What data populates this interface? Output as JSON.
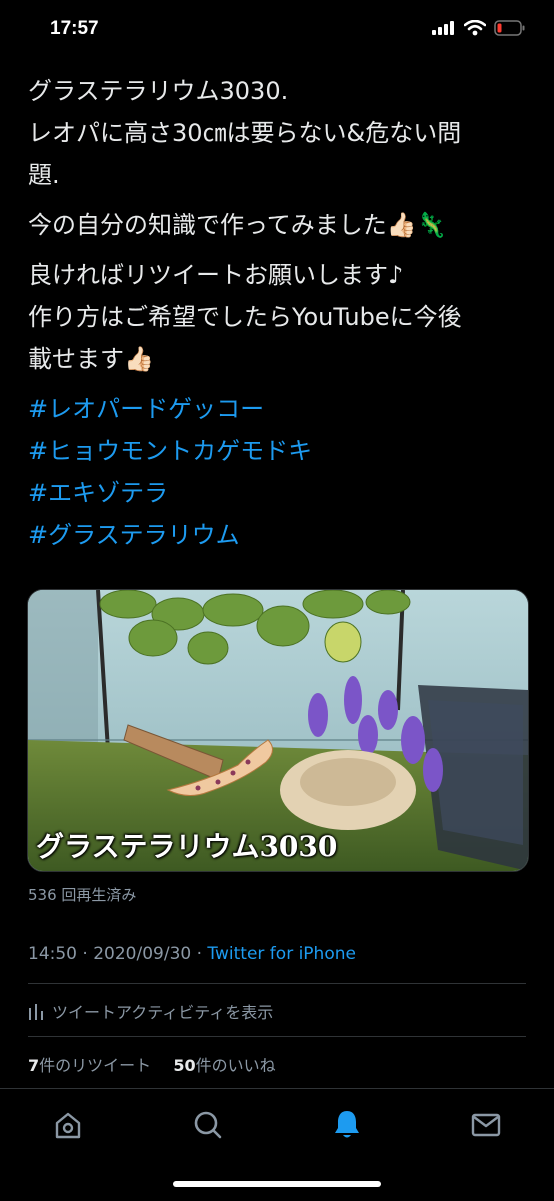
{
  "status_bar": {
    "time": "17:57"
  },
  "tweet": {
    "paragraphs": [
      [
        "グラステラリウム3030.",
        "レオパに高さ30㎝は要らない&危ない問",
        "題."
      ],
      [
        "今の自分の知識で作ってみました👍🏻🦎"
      ],
      [
        "良ければリツイートお願いします♪",
        "作り方はご希望でしたらYouTubeに今後",
        "載せます👍🏻"
      ]
    ],
    "hashtags": [
      "#レオパードゲッコー",
      "#ヒョウモントカゲモドキ",
      "#エキゾテラ",
      "#グラステラリウム"
    ]
  },
  "media": {
    "caption": "グラステラリウム3030"
  },
  "view_count": "536 回再生済み",
  "meta": {
    "time": "14:50",
    "date": "2020/09/30",
    "source": "Twitter for iPhone"
  },
  "activity_label": "ツイートアクティビティを表示",
  "stats": {
    "retweets_count": "7",
    "retweets_label": "件のリツイート",
    "likes_count": "50",
    "likes_label": "件のいいね"
  },
  "tabbar": {
    "active_tab": "notifications",
    "accent": "#1d9bf0"
  },
  "icons": [
    "home-icon",
    "search-icon",
    "notifications-icon",
    "messages-icon"
  ]
}
